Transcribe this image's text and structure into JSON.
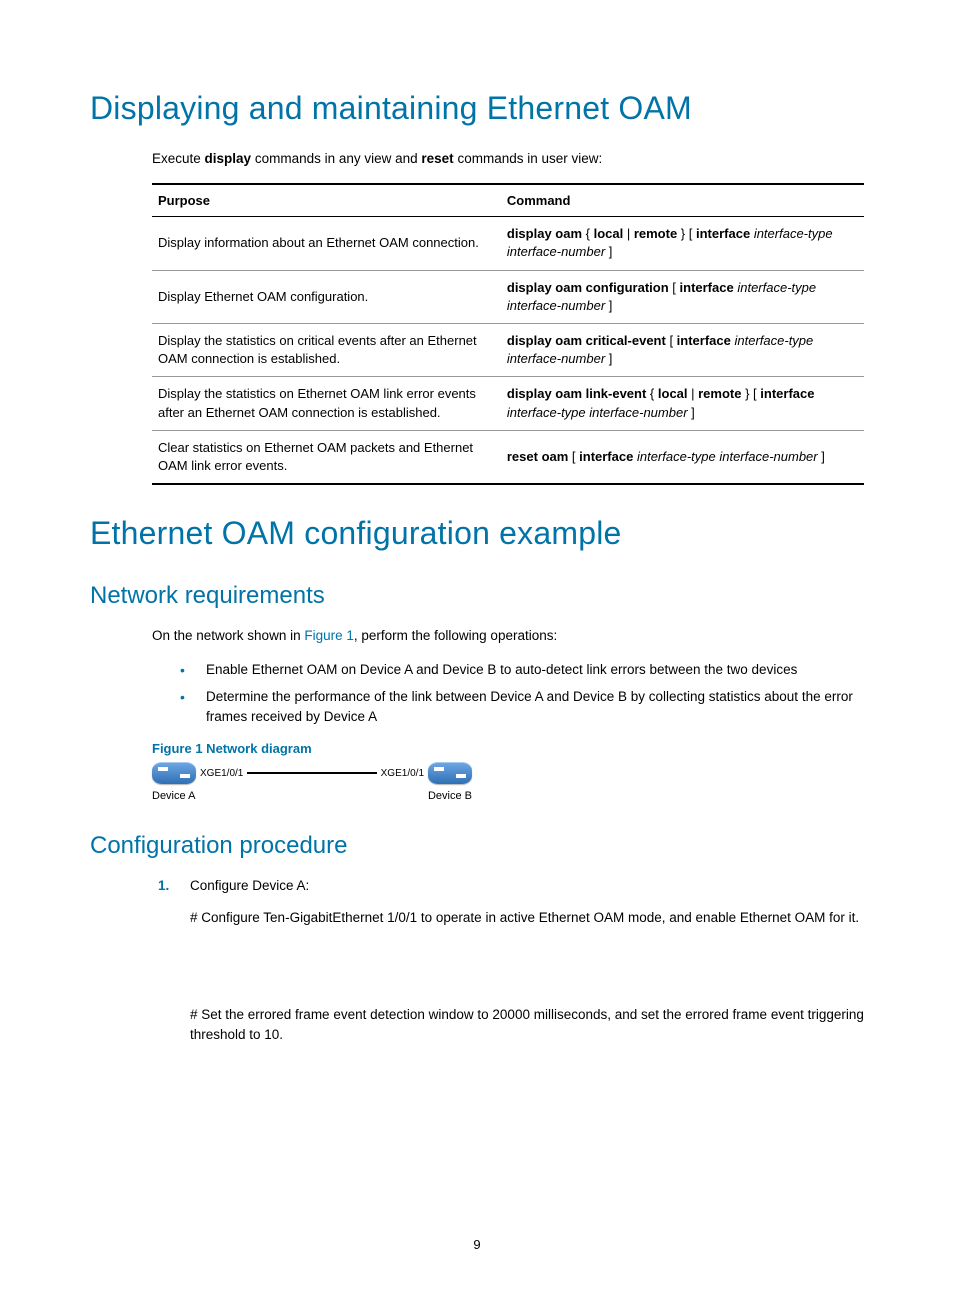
{
  "h1_1": "Displaying and maintaining Ethernet OAM",
  "intro": {
    "pre1": "Execute ",
    "b1": "display",
    "mid1": " commands in any view and ",
    "b2": "reset",
    "post1": " commands in user view:"
  },
  "table": {
    "header_purpose": "Purpose",
    "header_command": "Command",
    "rows": [
      {
        "purpose": "Display information about an Ethernet OAM connection.",
        "cmd_parts": [
          "<b>display oam</b> { <b>local</b> | <b>remote</b> } [ <b>interface</b> <i>interface-type interface-number</i> ]"
        ]
      },
      {
        "purpose": "Display Ethernet OAM configuration.",
        "cmd_parts": [
          "<b>display oam configuration</b> [ <b>interface</b> <i>interface-type interface-number</i> ]"
        ]
      },
      {
        "purpose": "Display the statistics on critical events after an Ethernet OAM connection is established.",
        "cmd_parts": [
          "<b>display oam critical-event</b> [ <b>interface</b> <i>interface-type interface-number</i> ]"
        ]
      },
      {
        "purpose": "Display the statistics on Ethernet OAM link error events after an Ethernet OAM connection is established.",
        "cmd_parts": [
          "<b>display oam link-event</b> { <b>local</b> | <b>remote</b> } [ <b>interface</b> <i>interface-type interface-number</i> ]"
        ]
      },
      {
        "purpose": "Clear statistics on Ethernet OAM packets and Ethernet OAM link error events.",
        "cmd_parts": [
          "<b>reset oam</b> [ <b>interface</b> <i>interface-type interface-number</i> ]"
        ]
      }
    ]
  },
  "h1_2": "Ethernet OAM configuration example",
  "h2_1": "Network requirements",
  "net_req_intro_pre": "On the network shown in ",
  "net_req_intro_link": "Figure 1",
  "net_req_intro_post": ", perform the following operations:",
  "bullets": [
    "Enable Ethernet OAM on Device A and Device B to auto-detect link errors between the two devices",
    "Determine the performance of the link between Device A and Device B by collecting statistics about the error frames received by Device A"
  ],
  "figure_caption": "Figure 1 Network diagram",
  "figure": {
    "port_left": "XGE1/0/1",
    "port_right": "XGE1/0/1",
    "dev_left": "Device A",
    "dev_right": "Device B"
  },
  "h2_2": "Configuration procedure",
  "step1_label": "Configure Device A:",
  "step1_body": "# Configure Ten-GigabitEthernet 1/0/1 to operate in active Ethernet OAM mode, and enable Ethernet OAM for it.",
  "step1_body2": "# Set the errored frame event detection window to 20000 milliseconds, and set the errored frame event triggering threshold to 10.",
  "page_number": "9"
}
